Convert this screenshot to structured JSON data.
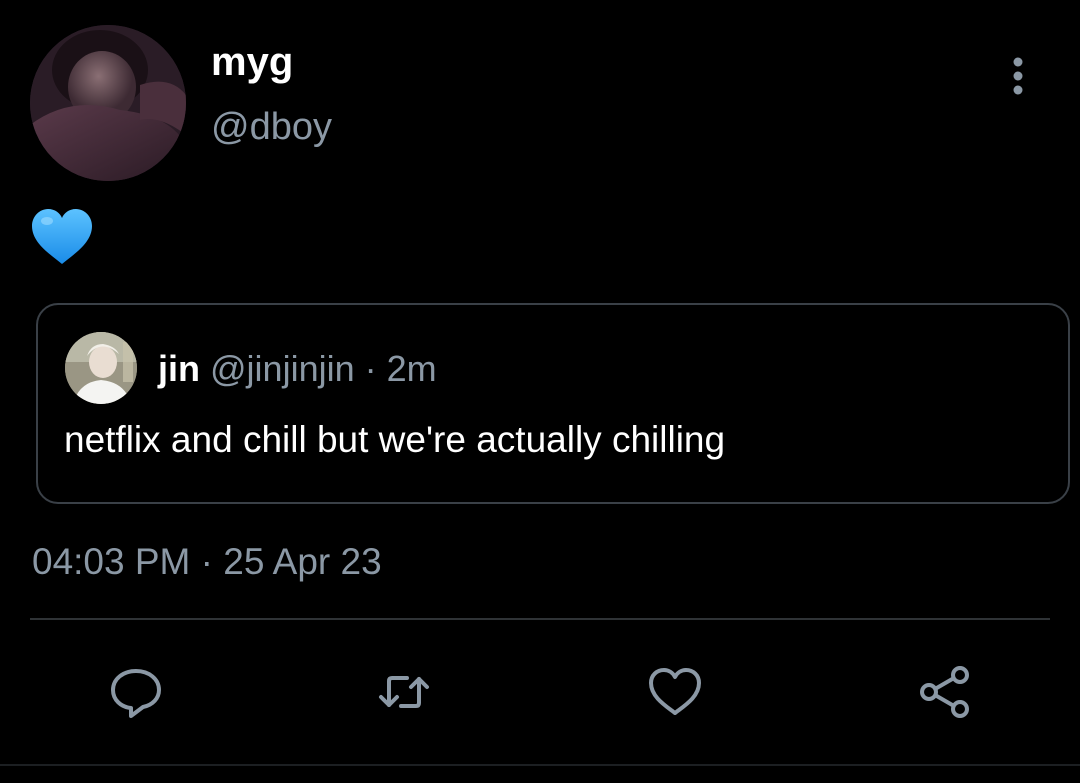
{
  "tweet": {
    "author": {
      "display_name": "myg",
      "handle": "@dboy",
      "avatar": "profile-photo"
    },
    "content": {
      "emoji": "blue-heart"
    },
    "quoted": {
      "display_name": "jin",
      "handle": "@jinjinjin",
      "separator": "·",
      "time": "2m",
      "text": "netflix and chill but we're actually chilling",
      "avatar": "profile-photo"
    },
    "timestamp": {
      "time": "04:03 PM",
      "separator": "·",
      "date": "25 Apr 23"
    }
  },
  "actions": {
    "reply_icon": "reply-icon",
    "retweet_icon": "retweet-icon",
    "like_icon": "heart-icon",
    "share_icon": "share-icon"
  },
  "colors": {
    "background": "#000000",
    "secondary_text": "#8b98a5",
    "primary_text": "#ffffff",
    "border": "#3a4047",
    "heart_emoji": "#2fa3f5"
  }
}
